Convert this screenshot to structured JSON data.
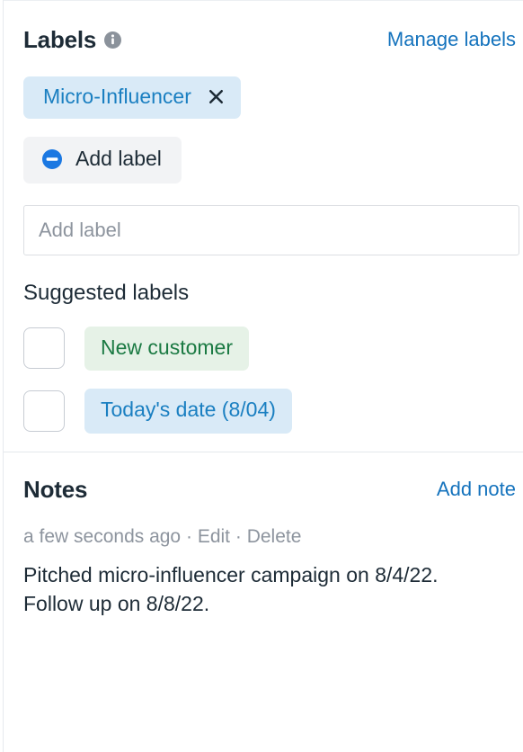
{
  "labels": {
    "title": "Labels",
    "info_icon": "info-circle-icon",
    "manage_link": "Manage labels",
    "applied": [
      {
        "text": "Micro-Influencer",
        "remove_icon": "close-x-icon",
        "bg": "#d9eaf7",
        "fg": "#1a7fc1"
      }
    ],
    "add_button": {
      "label": "Add label",
      "icon": "minus-circle-icon",
      "icon_color": "#1b78e2"
    },
    "input": {
      "value": "",
      "placeholder": "Add label"
    },
    "suggested_title": "Suggested labels",
    "suggested": [
      {
        "text": "New customer",
        "checked": false,
        "bg": "#e6f2e7",
        "fg": "#1b7a43"
      },
      {
        "text": "Today's date (8/04)",
        "checked": false,
        "bg": "#d9eaf7",
        "fg": "#1a7fc1"
      }
    ]
  },
  "notes": {
    "title": "Notes",
    "add_link": "Add note",
    "items": [
      {
        "timestamp": "a few seconds ago",
        "sep1": "·",
        "edit": "Edit",
        "sep2": "·",
        "delete": "Delete",
        "body": "Pitched micro-influencer campaign on 8/4/22. Follow up on 8/8/22."
      }
    ]
  },
  "colors": {
    "link": "#1573bd",
    "text": "#1d2b36",
    "muted": "#8d949e"
  }
}
